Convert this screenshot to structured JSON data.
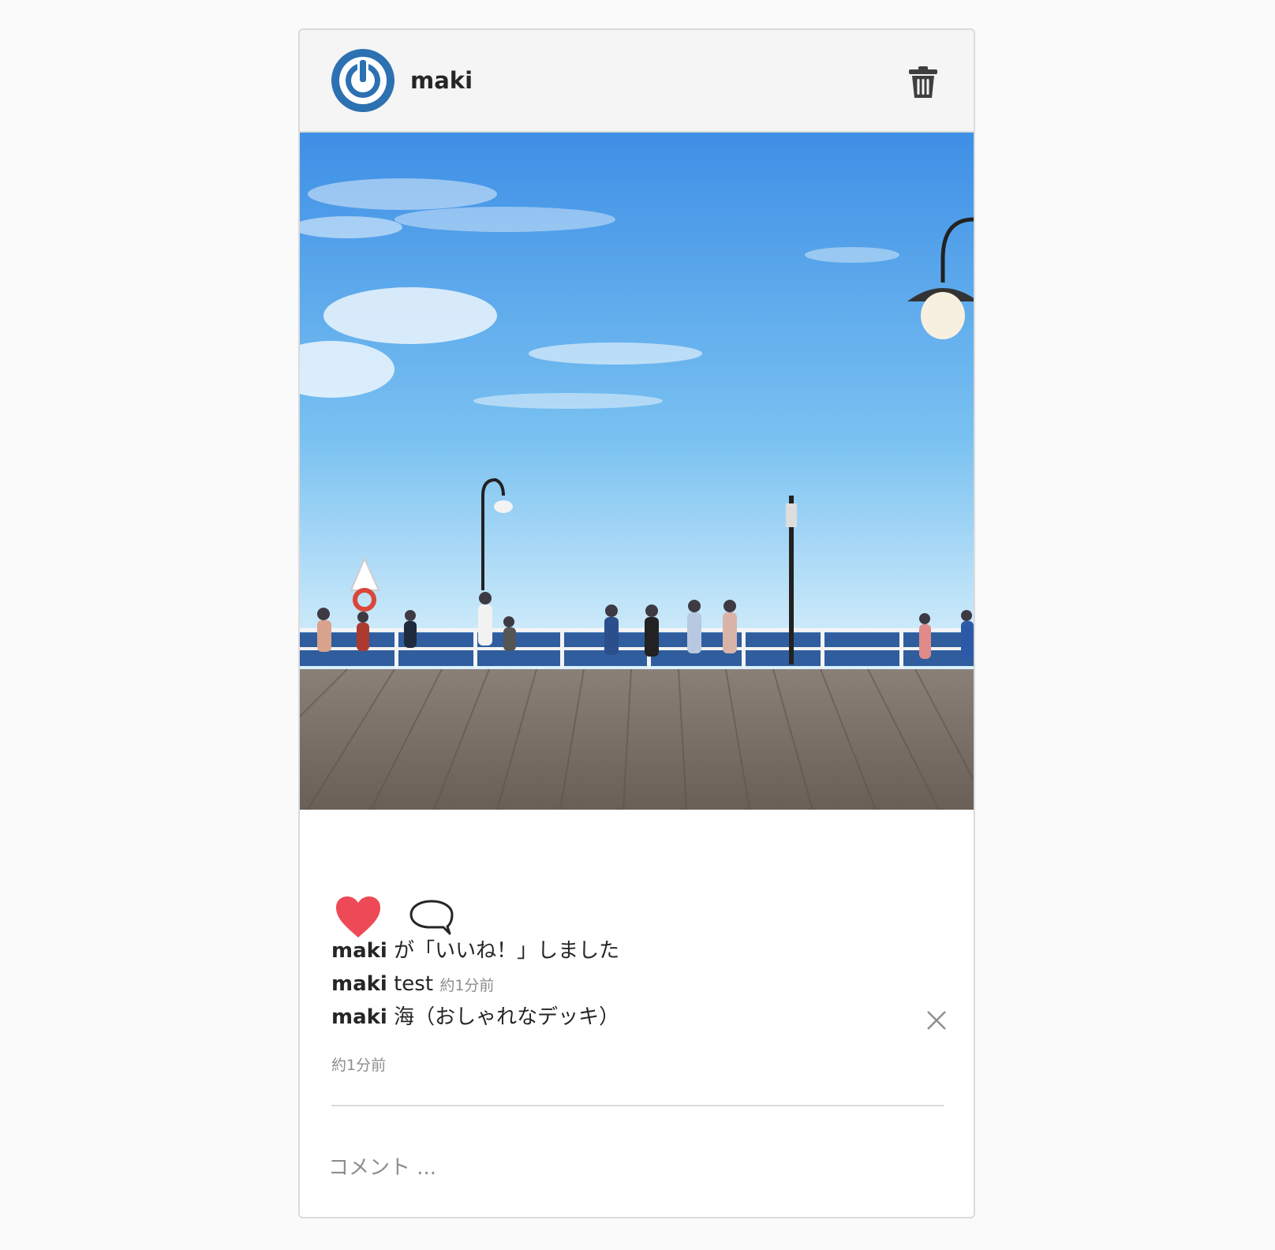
{
  "post": {
    "username": "maki",
    "likes_line": {
      "user": "maki",
      "text": " が「いいね！」しました"
    },
    "comments": [
      {
        "user": "maki",
        "text": " test ",
        "time": "約1分前"
      },
      {
        "user": "maki",
        "text": " 海（おしゃれなデッキ）"
      }
    ],
    "posted_time": "約1分前",
    "comment_placeholder": "コメント ...",
    "liked": true
  },
  "colors": {
    "heart": "#ed4956",
    "avatar_ring": "#2c71b1",
    "header_bg": "#f5f5f5"
  },
  "icons": {
    "avatar": "power-icon",
    "delete": "trash-icon",
    "like": "heart-icon",
    "comment": "speech-bubble-icon",
    "remove": "close-icon"
  }
}
